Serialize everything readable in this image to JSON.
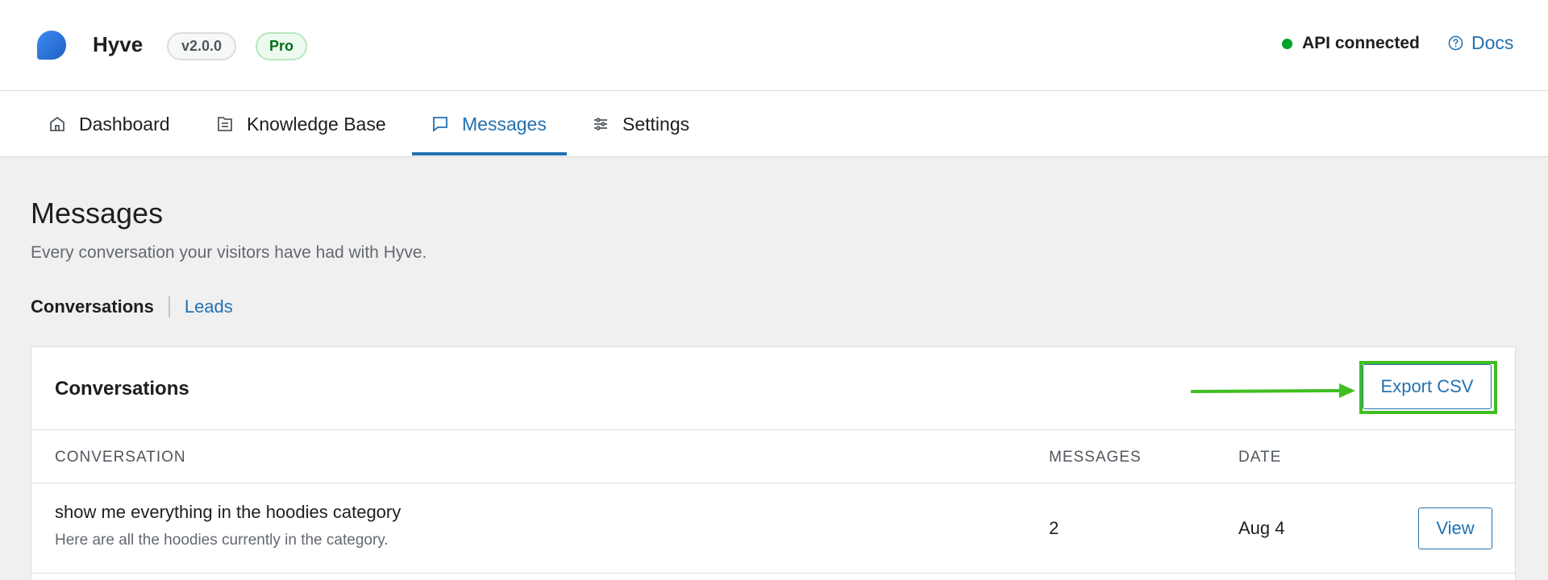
{
  "header": {
    "app_name": "Hyve",
    "version": "v2.0.0",
    "plan_badge": "Pro",
    "api_status": "API connected",
    "docs_label": "Docs",
    "logo_color": "#2b6fd6",
    "status_color": "#00a32a"
  },
  "tabs": [
    {
      "label": "Dashboard",
      "icon": "home-icon"
    },
    {
      "label": "Knowledge Base",
      "icon": "document-icon"
    },
    {
      "label": "Messages",
      "icon": "chat-bubble-icon",
      "active": true
    },
    {
      "label": "Settings",
      "icon": "sliders-icon"
    }
  ],
  "page": {
    "title": "Messages",
    "subtitle": "Every conversation your visitors have had with Hyve."
  },
  "subtabs": {
    "active": "Conversations",
    "link": "Leads"
  },
  "card": {
    "title": "Conversations",
    "export_label": "Export CSV",
    "columns": [
      "CONVERSATION",
      "MESSAGES",
      "DATE"
    ],
    "rows": [
      {
        "title": "show me everything in the hoodies category",
        "snippet": "Here are all the hoodies currently in the category.",
        "messages": "2",
        "date": "Aug 4",
        "action": "View"
      }
    ]
  },
  "annotation": {
    "highlight_color": "#3fbf1f"
  },
  "accent_color": "#2271b1"
}
